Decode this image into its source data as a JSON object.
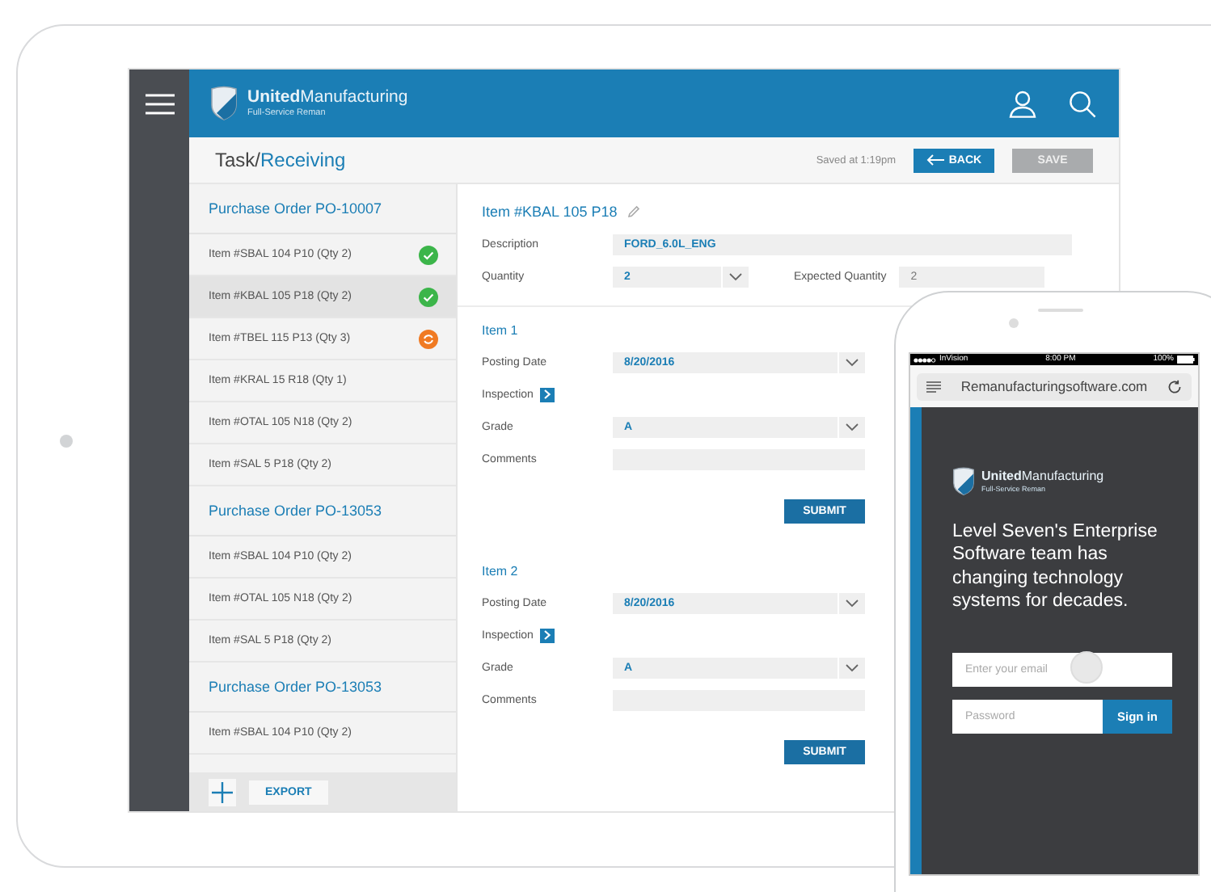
{
  "tablet": {
    "brand": {
      "name": "**United**Manufacturing",
      "tagline": "Full-Service Reman"
    },
    "breadcrumb": {
      "parent": "Task/",
      "current": "Receiving"
    },
    "saved_status": "Saved at 1:19pm",
    "buttons": [
      {
        "label": "BACK",
        "kind": "back"
      },
      {
        "label": "SAVE",
        "kind": "save"
      }
    ],
    "sidebar": {
      "groups": [
        {
          "title": "Purchase Order PO-10007",
          "items": [
            {
              "label": "Item #SBAL 104 P10 (Qty 2)",
              "selected": false,
              "kind": "done"
            },
            {
              "label": "Item #KBAL 105 P18 (Qty 2)",
              "selected": true,
              "kind": "done"
            },
            {
              "label": "Item #TBEL 115 P13 (Qty 3)",
              "selected": false,
              "kind": "pending"
            },
            {
              "label": "Item #KRAL 15 R18 (Qty 1)",
              "selected": false
            },
            {
              "label": "Item #OTAL 105 N18 (Qty 2)",
              "selected": false
            },
            {
              "label": "Item #SAL 5 P18 (Qty 2)",
              "selected": false
            }
          ]
        },
        {
          "title": "Purchase Order PO-13053",
          "items": [
            {
              "label": "Item #SBAL 104 P10 (Qty 2)",
              "selected": false
            },
            {
              "label": "Item #OTAL 105 N18 (Qty 2)",
              "selected": false
            },
            {
              "label": "Item #SAL 5 P18 (Qty 2)",
              "selected": false
            }
          ]
        },
        {
          "title": "Purchase Order PO-13053",
          "items": [
            {
              "label": "Item #SBAL 104 P10 (Qty 2)",
              "selected": false
            }
          ]
        }
      ],
      "export_button": "EXPORT"
    },
    "detail": {
      "title": "Item #KBAL 105 P18",
      "description": {
        "label": "Description",
        "value": "FORD_6.0L_ENG"
      },
      "quantity": {
        "label": "Quantity",
        "value": "2"
      },
      "expected_quantity": {
        "label": "Expected Quantity",
        "value": "2"
      },
      "items": [
        {
          "title": "Item 1",
          "fields": [
            {
              "label": "Posting Date",
              "kind": "select",
              "value": "8/20/2016"
            },
            {
              "label": "Inspection",
              "kind": "link"
            },
            {
              "label": "Grade",
              "kind": "select",
              "value": "A"
            },
            {
              "label": "Comments",
              "kind": "text"
            }
          ],
          "submit": "SUBMIT"
        },
        {
          "title": "Item 2",
          "fields": [
            {
              "label": "Posting Date",
              "kind": "select",
              "value": "8/20/2016"
            },
            {
              "label": "Inspection",
              "kind": "link"
            },
            {
              "label": "Grade",
              "kind": "select",
              "value": "A"
            },
            {
              "label": "Comments",
              "kind": "text"
            }
          ],
          "submit": "SUBMIT"
        }
      ]
    }
  },
  "phone": {
    "status_bar": {
      "carrier": "InVision",
      "time": "8:00 PM",
      "battery": "100%"
    },
    "url": "Remanufacturingsoftware.com",
    "brand": {
      "name": "**United**Manufacturing",
      "tagline": "Full-Service Reman"
    },
    "headline": "Level Seven's Enterprise Software team has changing technology systems for decades.",
    "email": {
      "placeholder": "Enter your email"
    },
    "password": {
      "placeholder": "Password"
    },
    "sign_in_button": "Sign in"
  }
}
